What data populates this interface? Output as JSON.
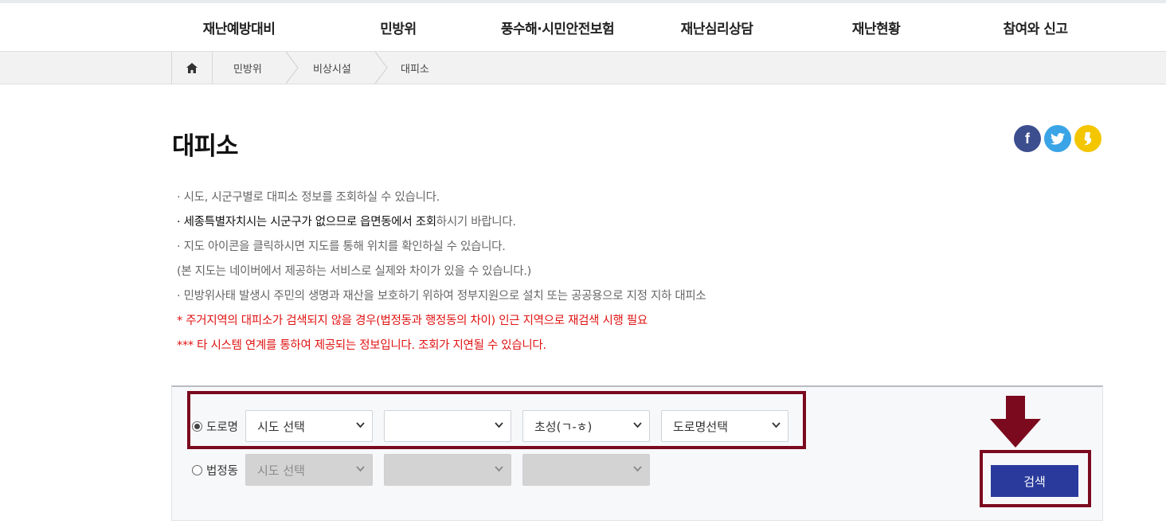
{
  "nav": {
    "items": [
      "재난예방대비",
      "민방위",
      "풍수해·시민안전보험",
      "재난심리상담",
      "재난현황",
      "참여와 신고"
    ]
  },
  "breadcrumb": {
    "items": [
      "민방위",
      "비상시설",
      "대피소"
    ]
  },
  "page": {
    "title": "대피소"
  },
  "sns": {
    "facebook_glyph": "f"
  },
  "info": {
    "line1": "· 시도, 시군구별로 대피소 정보를 조회하실 수 있습니다.",
    "line2a": "· 세종특별자치시는 시군구가 없으므로 읍면동에서 조회",
    "line2b": "하시기 바랍니다.",
    "line3": "· 지도 아이콘을 클릭하시면 지도를 통해 위치를 확인하실 수 있습니다.",
    "line4": "(본 지도는 네이버에서 제공하는 서비스로 실제와 차이가 있을 수 있습니다.)",
    "line5": "· 민방위사태 발생시 주민의 생명과 재산을 보호하기 위하여 정부지원으로 설치 또는 공공용으로 지정 지하 대피소",
    "line6": "* 주거지역의 대피소가 검색되지 않을 경우(법정동과 행정동의 차이) 인근 지역으로 재검색 시행 필요",
    "line7": "*** 타 시스템 연계를 통하여 제공되는 정보입니다. 조회가 지연될 수 있습니다."
  },
  "search": {
    "road": {
      "label": "도로명",
      "selected": true,
      "sido": "시도 선택",
      "sigungu": "",
      "initial": "초성(ㄱ-ㅎ)",
      "road_name": "도로명선택"
    },
    "legal": {
      "label": "법정동",
      "selected": false,
      "sido": "시도 선택",
      "sigungu": "",
      "dong": ""
    },
    "button_label": "검색"
  },
  "colors": {
    "highlight": "#7b0a1e",
    "search_button": "#2a3a9c",
    "notice_red": "#e01212"
  }
}
